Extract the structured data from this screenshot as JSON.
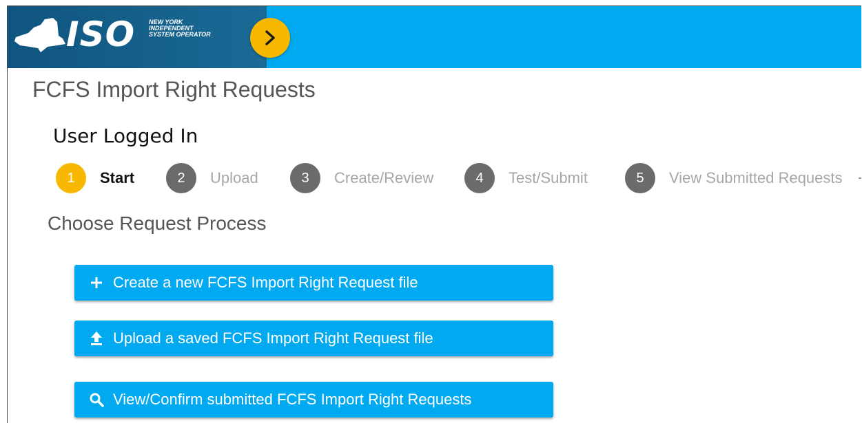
{
  "header": {
    "logo_text": "ISO",
    "tagline": [
      "NEW YORK",
      "INDEPENDENT",
      "SYSTEM OPERATOR"
    ],
    "colors": {
      "bar": "#00a9f0",
      "brand": "#0f557f",
      "accent": "#f8b800"
    },
    "toggle_icon": "chevron-right-icon"
  },
  "page": {
    "title": "FCFS Import Right Requests",
    "user_status": "User Logged In"
  },
  "stepper": {
    "steps": [
      {
        "number": "1",
        "label": "Start",
        "active": true
      },
      {
        "number": "2",
        "label": "Upload",
        "active": false
      },
      {
        "number": "3",
        "label": "Create/Review",
        "active": false
      },
      {
        "number": "4",
        "label": "Test/Submit",
        "active": false
      },
      {
        "number": "5",
        "label": "View Submitted Requests",
        "active": false
      }
    ]
  },
  "section": {
    "title": "Choose Request Process",
    "actions": [
      {
        "label": "Create a new FCFS Import Right Request file",
        "icon": "plus-icon"
      },
      {
        "label": "Upload a saved FCFS Import Right Request file",
        "icon": "upload-icon"
      },
      {
        "label": "View/Confirm submitted FCFS Import Right Requests",
        "icon": "search-icon"
      }
    ]
  }
}
